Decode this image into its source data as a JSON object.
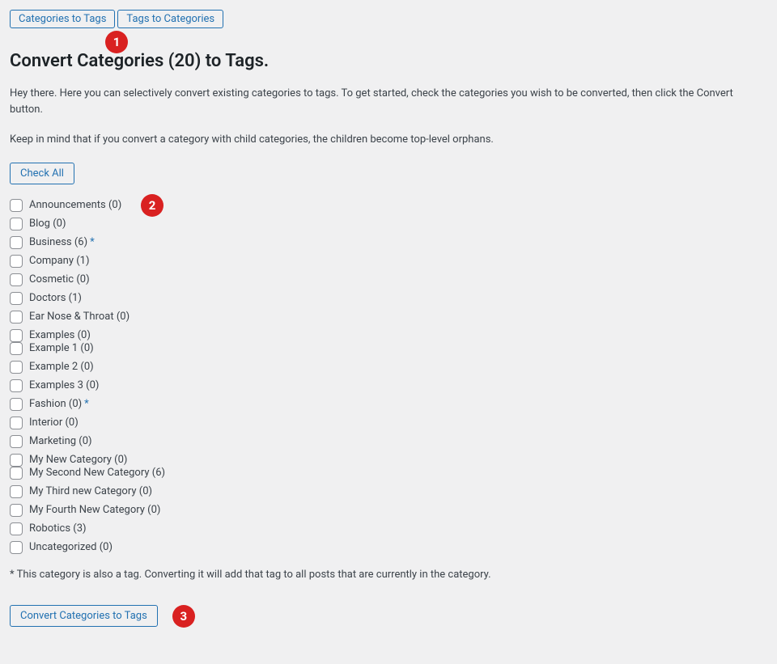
{
  "tabs": {
    "cat_to_tags": "Categories to Tags",
    "tags_to_cat": "Tags to Categories"
  },
  "annotations": {
    "a1": "1",
    "a2": "2",
    "a3": "3"
  },
  "heading": "Convert Categories (20) to Tags.",
  "intro1": "Hey there. Here you can selectively convert existing categories to tags. To get started, check the categories you wish to be converted, then click the Convert button.",
  "intro2": "Keep in mind that if you convert a category with child categories, the children become top-level orphans.",
  "check_all": "Check All",
  "categories": [
    {
      "label": "Announcements (0)",
      "also_tag": false,
      "tight": false
    },
    {
      "label": "Blog (0)",
      "also_tag": false,
      "tight": false
    },
    {
      "label": "Business (6)",
      "also_tag": true,
      "tight": false
    },
    {
      "label": "Company (1)",
      "also_tag": false,
      "tight": false
    },
    {
      "label": "Cosmetic (0)",
      "also_tag": false,
      "tight": false
    },
    {
      "label": "Doctors (1)",
      "also_tag": false,
      "tight": false
    },
    {
      "label": "Ear Nose & Throat (0)",
      "also_tag": false,
      "tight": false
    },
    {
      "label": "Examples (0)",
      "also_tag": false,
      "tight": true
    },
    {
      "label": "Example 1 (0)",
      "also_tag": false,
      "tight": false
    },
    {
      "label": "Example 2 (0)",
      "also_tag": false,
      "tight": false
    },
    {
      "label": "Examples 3 (0)",
      "also_tag": false,
      "tight": false
    },
    {
      "label": "Fashion (0)",
      "also_tag": true,
      "tight": false
    },
    {
      "label": "Interior (0)",
      "also_tag": false,
      "tight": false
    },
    {
      "label": "Marketing (0)",
      "also_tag": false,
      "tight": false
    },
    {
      "label": "My New Category (0)",
      "also_tag": false,
      "tight": true
    },
    {
      "label": "My Second New Category (6)",
      "also_tag": false,
      "tight": false
    },
    {
      "label": "My Third new Category (0)",
      "also_tag": false,
      "tight": false
    },
    {
      "label": "My Fourth New Category (0)",
      "also_tag": false,
      "tight": false
    },
    {
      "label": "Robotics (3)",
      "also_tag": false,
      "tight": false
    },
    {
      "label": "Uncategorized (0)",
      "also_tag": false,
      "tight": false
    }
  ],
  "asterisk": "*",
  "footnote": "* This category is also a tag. Converting it will add that tag to all posts that are currently in the category.",
  "convert_button": "Convert Categories to Tags"
}
